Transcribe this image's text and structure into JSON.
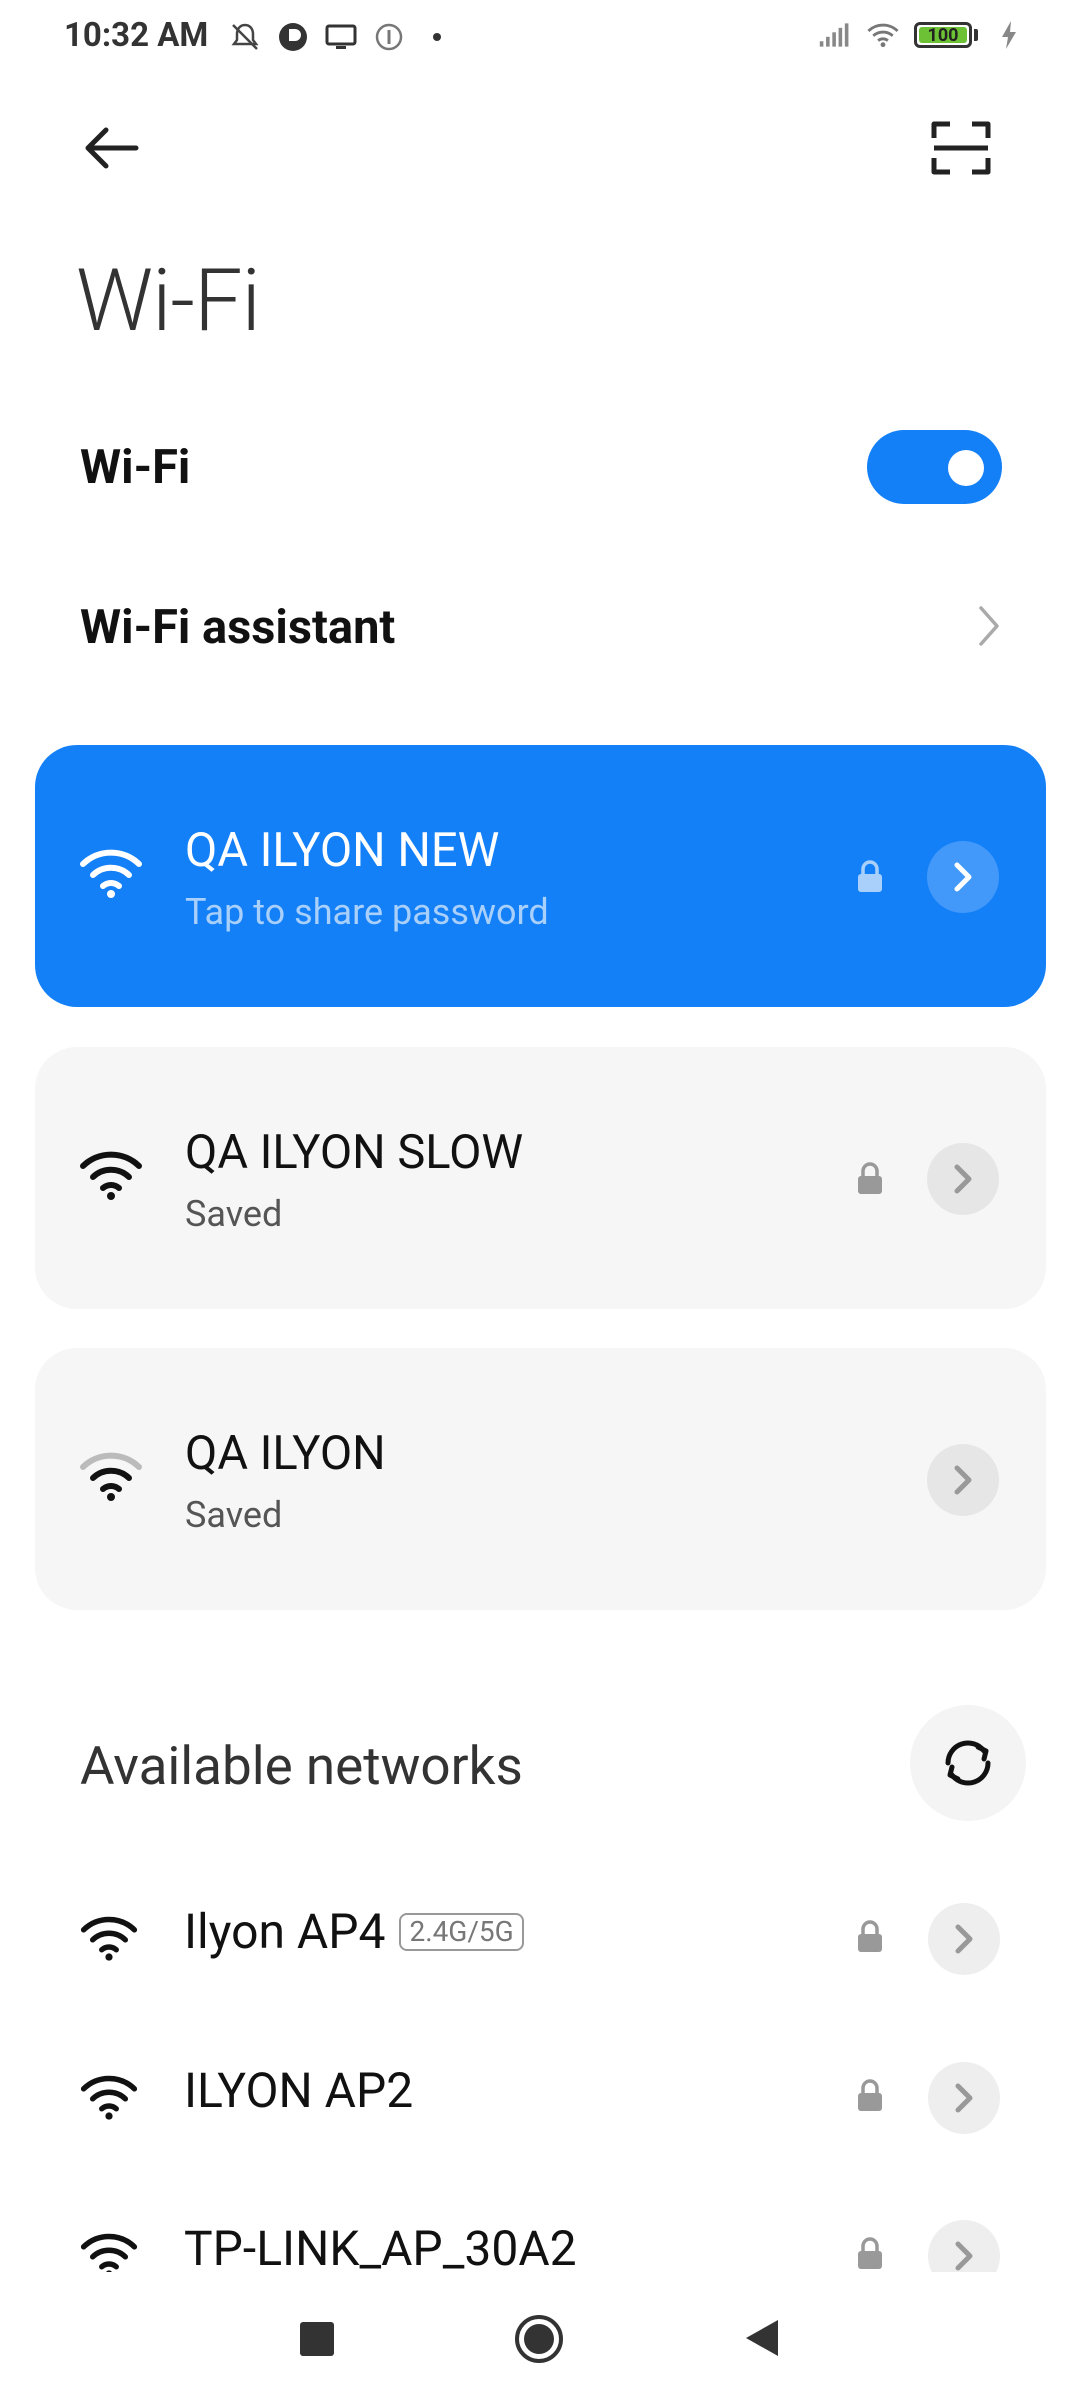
{
  "status_bar": {
    "time": "10:32 AM",
    "battery": "100",
    "left_icons": [
      "notifications-off-icon",
      "app-icon",
      "screen-mirror-icon",
      "info-icon",
      "dot-icon"
    ],
    "right_icons": [
      "signal-icon",
      "wifi-icon",
      "battery-icon",
      "charging-icon"
    ]
  },
  "header": {
    "title": "Wi-Fi"
  },
  "wifi_toggle": {
    "label": "Wi-Fi",
    "enabled": true
  },
  "assistant": {
    "label": "Wi-Fi assistant"
  },
  "connected_networks": [
    {
      "name": "QA ILYON NEW",
      "subtitle": "Tap to share password",
      "secured": true,
      "active": true
    },
    {
      "name": "QA ILYON SLOW",
      "subtitle": "Saved",
      "secured": true,
      "active": false
    },
    {
      "name": "QA ILYON",
      "subtitle": "Saved",
      "secured": false,
      "active": false
    }
  ],
  "available": {
    "title": "Available networks",
    "networks": [
      {
        "name": "Ilyon AP4",
        "badge": "2.4G/5G",
        "secured": true
      },
      {
        "name": "ILYON AP2",
        "badge": "",
        "secured": true
      },
      {
        "name": "TP-LINK_AP_30A2",
        "badge": "",
        "secured": true
      }
    ]
  },
  "colors": {
    "accent": "#1480f7",
    "card_gray": "#f6f6f6"
  }
}
